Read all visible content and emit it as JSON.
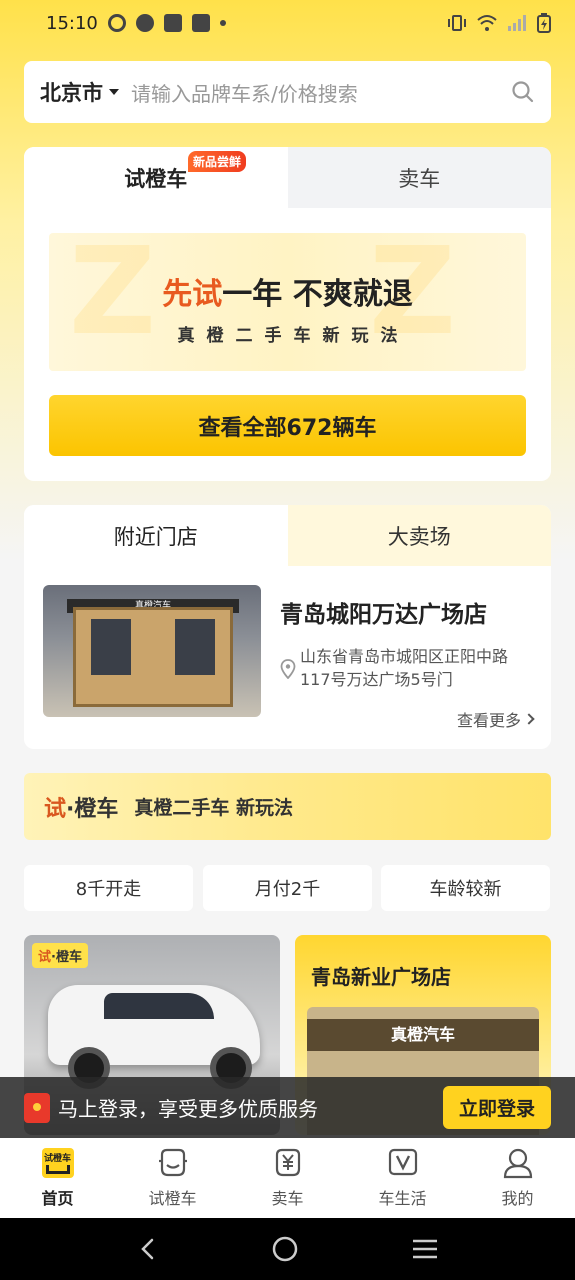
{
  "status_bar": {
    "time": "15:10"
  },
  "search": {
    "city": "北京市",
    "placeholder": "请输入品牌车系/价格搜索"
  },
  "card1": {
    "tabs": [
      {
        "label": "试橙车",
        "badge": "新品尝鲜",
        "active": true
      },
      {
        "label": "卖车",
        "active": false
      }
    ],
    "promo": {
      "title_highlight": "先试",
      "title_rest": "一年  不爽就退",
      "subtitle": "真橙二手车新玩法"
    },
    "view_all_button": "查看全部672辆车"
  },
  "card2": {
    "tabs": [
      {
        "label": "附近门店",
        "active": true
      },
      {
        "label": "大卖场",
        "active": false
      }
    ],
    "store": {
      "name": "青岛城阳万达广场店",
      "address": "山东省青岛市城阳区正阳中路117号万达广场5号门",
      "see_more": "查看更多",
      "image_sign": "真橙汽车"
    }
  },
  "banner": {
    "logo_a": "试",
    "logo_dot": "·",
    "logo_b": "橙车",
    "text": "真橙二手车 新玩法"
  },
  "chips": [
    "8千开走",
    "月付2千",
    "车龄较新"
  ],
  "products": {
    "car_tag_a": "试",
    "car_tag_dot": "·",
    "car_tag_b": "橙车",
    "store_card_name": "青岛新业广场店",
    "store_card_sign": "真橙汽车"
  },
  "login_bar": {
    "text": "马上登录，享受更多优质服务",
    "button": "立即登录"
  },
  "bottom_nav": [
    {
      "label": "首页",
      "icon": "home-logo-icon",
      "active": true
    },
    {
      "label": "试橙车",
      "icon": "try-car-icon",
      "active": false
    },
    {
      "label": "卖车",
      "icon": "sell-car-icon",
      "active": false
    },
    {
      "label": "车生活",
      "icon": "car-life-icon",
      "active": false
    },
    {
      "label": "我的",
      "icon": "profile-icon",
      "active": false
    }
  ],
  "home_logo_text": "试橙车",
  "colors": {
    "brand_yellow": "#ffd21f",
    "accent_orange": "#e85a1f",
    "badge_red": "#f03c1f"
  }
}
